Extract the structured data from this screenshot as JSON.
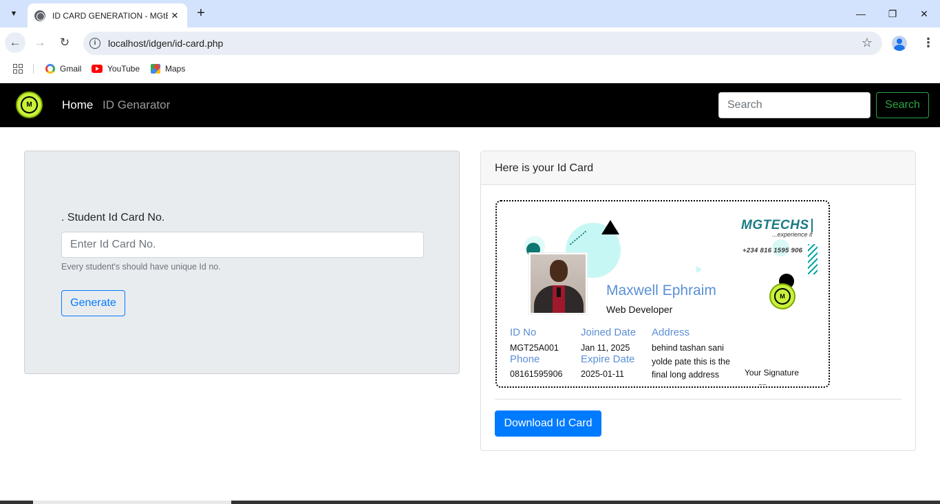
{
  "browser": {
    "tab_title": "ID CARD GENERATION - MGtECH",
    "url": "localhost/idgen/id-card.php",
    "bookmarks": [
      {
        "label": "Gmail"
      },
      {
        "label": "YouTube"
      },
      {
        "label": "Maps"
      }
    ]
  },
  "navbar": {
    "links": {
      "home": "Home",
      "generator": "ID Genarator"
    },
    "search_placeholder": "Search",
    "search_button": "Search",
    "logo_text": "M"
  },
  "form": {
    "label": ". Student Id Card No.",
    "input_placeholder": "Enter Id Card No.",
    "help_text": "Every student's should have unique Id no.",
    "generate_button": "Generate"
  },
  "card_panel": {
    "header": "Here is your Id Card",
    "download_button": "Download Id Card"
  },
  "id_card": {
    "name": "Maxwell Ephraim",
    "role": "Web Developer",
    "brand": "MGTECHS",
    "tagline": "...experience it",
    "phone_contact": "+234 816 1595 906",
    "logo_text": "M",
    "fields": {
      "id_label": "ID No",
      "id_value": "MGT25A001",
      "joined_label": "Joined Date",
      "joined_value": "Jan 11, 2025",
      "address_label": "Address",
      "address_value": "behind tashan sani yolde pate this is the final long address",
      "phone_label": "Phone",
      "phone_value": "08161595906",
      "expire_label": "Expire Date",
      "expire_value": "2025-01-11"
    },
    "signature_label": "Your Signature"
  },
  "colors": {
    "accent_blue": "#007bff",
    "success_green": "#28a745",
    "card_label_blue": "#5b8fd6",
    "brand_teal": "#1a7a85",
    "logo_lime": "#c8f23a"
  }
}
